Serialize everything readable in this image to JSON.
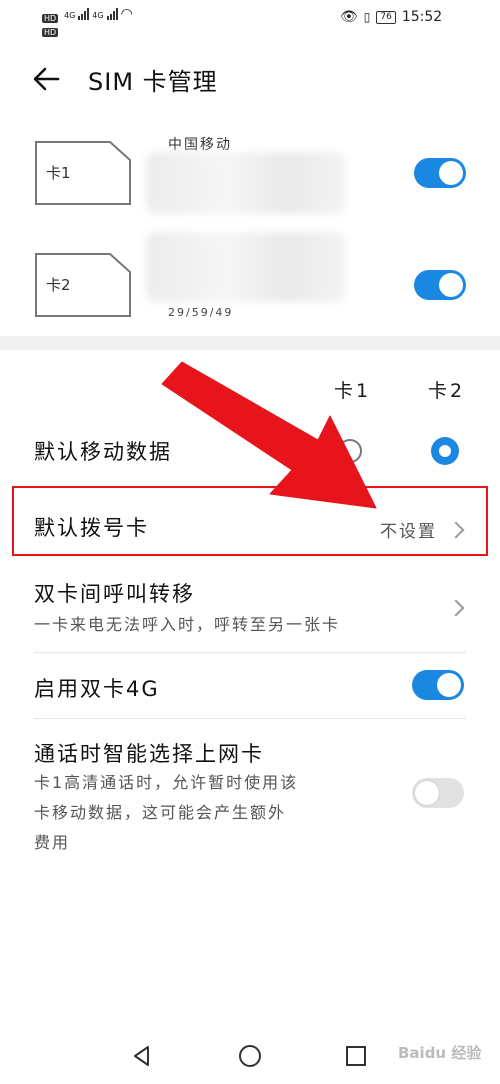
{
  "status_bar": {
    "hd1": "HD",
    "hd2": "HD",
    "net1": "4G",
    "net2": "4G",
    "battery": "76",
    "time": "15:52"
  },
  "header": {
    "back_icon": "arrow-left-icon",
    "title": "SIM 卡管理"
  },
  "sims": [
    {
      "label": "卡1",
      "carrier": "中国移动",
      "enabled": true
    },
    {
      "label": "卡2",
      "number_fragment": "29/59/49",
      "enabled": true
    }
  ],
  "settings": {
    "col_card1": "卡1",
    "col_card2": "卡2",
    "default_data": {
      "label": "默认移动数据",
      "selected": "卡2"
    },
    "default_dial": {
      "label": "默认拨号卡",
      "value": "不设置"
    },
    "call_forward": {
      "label": "双卡间呼叫转移",
      "description": "一卡来电无法呼入时，呼转至另一张卡"
    },
    "dual_4g": {
      "label": "启用双卡4G",
      "enabled": true
    },
    "smart_data": {
      "label": "通话时智能选择上网卡",
      "description_line1": "卡1高清通话时，允许暂时使用该",
      "description_line2": "卡移动数据，这可能会产生额外",
      "description_line3": "费用",
      "enabled": false
    }
  },
  "annotation": {
    "arrow_color": "#e8141c",
    "highlight_color": "#e8141c"
  },
  "watermark": "Baidu 经验",
  "nav_bar": {
    "back_icon": "triangle-back-icon",
    "home_icon": "circle-home-icon",
    "recent_icon": "square-recent-icon"
  }
}
